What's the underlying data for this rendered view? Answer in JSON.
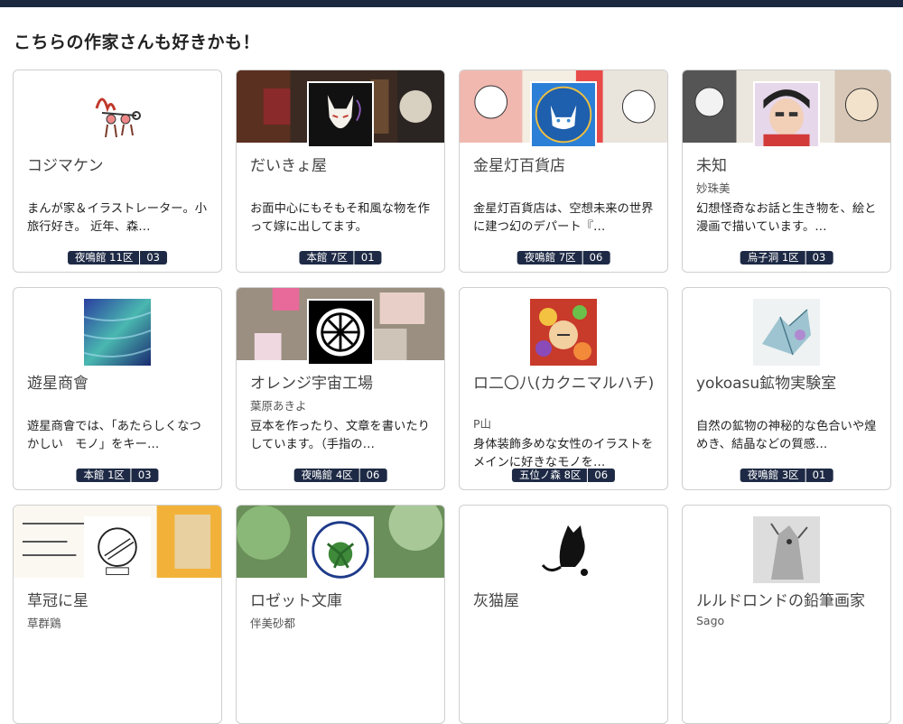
{
  "page": {
    "section_title": "こちらの作家さんも好きかも！"
  },
  "cards": [
    {
      "name": "コジマケン",
      "author": "",
      "desc": "まんが家＆イラストレーター。小旅行好き。 近年、森…",
      "hall": "夜鳴館 11区",
      "num": "03",
      "banner": false,
      "avatar": "kojima-logo",
      "accent": "#c0392b"
    },
    {
      "name": "だいきょ屋",
      "author": "",
      "desc": "お面中心にもそもそ和風な物を作って嫁に出してます。",
      "hall": "本館 7区",
      "num": "01",
      "banner": true,
      "avatar": "fox-mask",
      "accent": "#111111"
    },
    {
      "name": "金星灯百貨店",
      "author": "",
      "desc": "金星灯百貨店は、空想未来の世界に建つ幻のデパート『…",
      "hall": "夜鳴館 7区",
      "num": "06",
      "banner": true,
      "avatar": "cat-badge",
      "accent": "#2b7fd6"
    },
    {
      "name": "未知",
      "author": "妙珠美",
      "desc": "幻想怪奇なお話と生き物を、絵と漫画で描いています。…",
      "hall": "烏子洞 1区",
      "num": "03",
      "banner": true,
      "avatar": "face-portrait",
      "accent": "#d23a3a"
    },
    {
      "name": "遊星商會",
      "author": "",
      "desc": "遊星商會では、「あたらしくなつかしい　モノ」をキー…",
      "hall": "本館 1区",
      "num": "03",
      "banner": false,
      "avatar": "aurora",
      "accent": "#3a5fb8"
    },
    {
      "name": "オレンジ宇宙工場",
      "author": "葉原あきよ",
      "desc": "豆本を作ったり、文章を書いたりしています。（手指の…",
      "hall": "夜鳴館 4区",
      "num": "06",
      "banner": true,
      "avatar": "orange-wheel",
      "accent": "#000000"
    },
    {
      "name": "ロ二〇八(カクニマルハチ)",
      "author": "P山",
      "desc": "身体装飾多めな女性のイラストをメインに好きなモノを…",
      "hall": "五位ノ森 8区",
      "num": "06",
      "banner": false,
      "avatar": "colorful-girl",
      "accent": "#c0392b"
    },
    {
      "name": "yokoasu鉱物実験室",
      "author": "",
      "desc": "自然の鉱物の神秘的な色合いや煌めき、結晶などの質感…",
      "hall": "夜鳴館 3区",
      "num": "01",
      "banner": false,
      "avatar": "crystal",
      "accent": "#6fa8b8"
    },
    {
      "name": "草冠に星",
      "author": "草群鶏",
      "desc": "",
      "hall": "",
      "num": "",
      "banner": true,
      "avatar": "star-sketch",
      "accent": "#f2b23a"
    },
    {
      "name": "ロゼット文庫",
      "author": "伴美砂都",
      "desc": "",
      "hall": "",
      "num": "",
      "banner": true,
      "avatar": "rosette",
      "accent": "#3f8a3a"
    },
    {
      "name": "灰猫屋",
      "author": "",
      "desc": "",
      "hall": "",
      "num": "",
      "banner": false,
      "avatar": "black-cat",
      "accent": "#000000"
    },
    {
      "name": "ルルドロンドの鉛筆画家",
      "author": "Sago",
      "desc": "",
      "hall": "",
      "num": "",
      "banner": false,
      "avatar": "pencil-creature",
      "accent": "#777777"
    }
  ]
}
